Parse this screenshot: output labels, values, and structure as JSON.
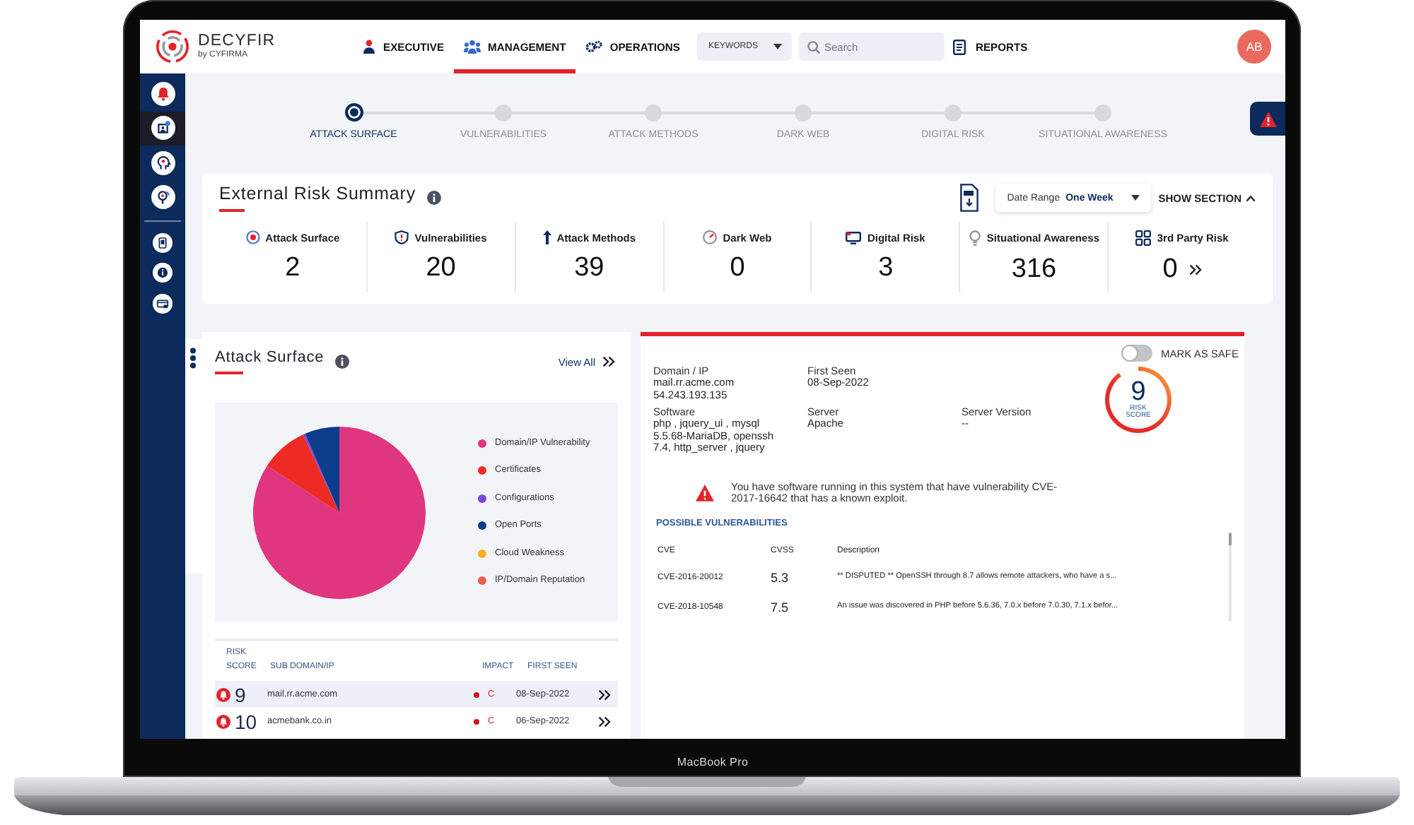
{
  "device": {
    "label": "MacBook Pro"
  },
  "header": {
    "logo": {
      "name": "DECYFIR",
      "tagline": "by CYFIRMA"
    },
    "tabs": [
      {
        "label": "EXECUTIVE",
        "selected": false
      },
      {
        "label": "MANAGEMENT",
        "selected": true
      },
      {
        "label": "OPERATIONS",
        "selected": false
      }
    ],
    "keywords": {
      "value": "KEYWORDS"
    },
    "search": {
      "placeholder": "Search"
    },
    "reports": {
      "label": "REPORTS"
    },
    "avatar": {
      "initials": "AB"
    }
  },
  "sidebar": {
    "groups": [
      {
        "items": [
          {
            "selected": false
          },
          {
            "selected": true
          },
          {
            "selected": false
          },
          {
            "selected": false
          }
        ]
      },
      {
        "items": [
          {
            "selected": false
          },
          {
            "selected": false
          },
          {
            "selected": false
          }
        ]
      }
    ]
  },
  "stepper": [
    {
      "label": "ATTACK SURFACE",
      "selected": true
    },
    {
      "label": "VULNERABILITIES",
      "selected": false
    },
    {
      "label": "ATTACK METHODS",
      "selected": false
    },
    {
      "label": "DARK WEB",
      "selected": false
    },
    {
      "label": "DIGITAL RISK",
      "selected": false
    },
    {
      "label": "SITUATIONAL AWARENESS",
      "selected": false
    }
  ],
  "summary": {
    "title": "External Risk Summary",
    "date_range": {
      "label": "Date Range",
      "value": "One Week"
    },
    "show_section": {
      "label": "SHOW SECTION",
      "expanded": true
    },
    "metrics": [
      {
        "kind": "count",
        "label": "Attack Surface",
        "value": "2"
      },
      {
        "kind": "count",
        "label": "Vulnerabilities",
        "value": "20"
      },
      {
        "kind": "count",
        "label": "Attack Methods",
        "value": "39"
      },
      {
        "kind": "count",
        "label": "Dark Web",
        "value": "0"
      },
      {
        "kind": "count",
        "label": "Digital Risk",
        "value": "3"
      },
      {
        "kind": "count",
        "label": "Situational Awareness",
        "value": "316"
      },
      {
        "kind": "link",
        "label": "3rd Party Risk",
        "value": "0"
      }
    ]
  },
  "attack_surface": {
    "title": "Attack Surface",
    "view_all": "View All",
    "legend": [
      {
        "label": "Domain/IP Vulnerability",
        "color": "#e0357f"
      },
      {
        "label": "Certificates",
        "color": "#ee2a24"
      },
      {
        "label": "Configurations",
        "color": "#7c47d8"
      },
      {
        "label": "Open Ports",
        "color": "#0c3d8c"
      },
      {
        "label": "Cloud Weakness",
        "color": "#f8b018"
      },
      {
        "label": "IP/Domain Reputation",
        "color": "#ef5b4b"
      }
    ],
    "table": {
      "columns": [
        "RISK SCORE",
        "SUB DOMAIN/IP",
        "IMPACT",
        "FIRST SEEN"
      ],
      "rows": [
        {
          "selected": true,
          "score": "9",
          "domain": "mail.rr.acme.com",
          "impact": "C",
          "color": "#d0101b",
          "first_seen": "08-Sep-2022"
        },
        {
          "selected": false,
          "score": "10",
          "domain": "acmebank.co.in",
          "impact": "C",
          "color": "#d0101b",
          "first_seen": "06-Sep-2022"
        }
      ]
    }
  },
  "detail": {
    "mark_as_safe": {
      "label": "MARK AS SAFE",
      "on": false
    },
    "risk": {
      "value": "9",
      "label": "RISK SCORE",
      "level": 0.9
    },
    "info_rows": [
      [
        {
          "label": "Domain / IP",
          "values": [
            "mail.rr.acme.com",
            "54.243.193.135"
          ]
        },
        {
          "label": "First Seen",
          "values": [
            "08-Sep-2022"
          ]
        }
      ],
      [
        {
          "label": "Software",
          "values": [
            "php , jquery_ui , mysql 5.5.68-MariaDB, openssh 7.4, http_server , jquery"
          ]
        },
        {
          "label": "Server",
          "values": [
            "Apache"
          ]
        },
        {
          "label": "Server Version",
          "values": [
            "--"
          ]
        }
      ]
    ],
    "warning": "You have software running in this system that have vulnerability CVE-2017-16642 that has a known exploit.",
    "vulnerabilities": {
      "title": "POSSIBLE VULNERABILITIES",
      "columns": [
        "CVE",
        "CVSS",
        "Description"
      ],
      "rows": [
        {
          "cve": "CVE-2016-20012",
          "cvss": "5.3",
          "description": "** DISPUTED ** OpenSSH through 8.7 allows remote attackers, who have a s..."
        },
        {
          "cve": "CVE-2018-10548",
          "cvss": "7.5",
          "description": "An issue was discovered in PHP before 5.6.36, 7.0.x before 7.0.30, 7.1.x befor..."
        }
      ]
    }
  }
}
